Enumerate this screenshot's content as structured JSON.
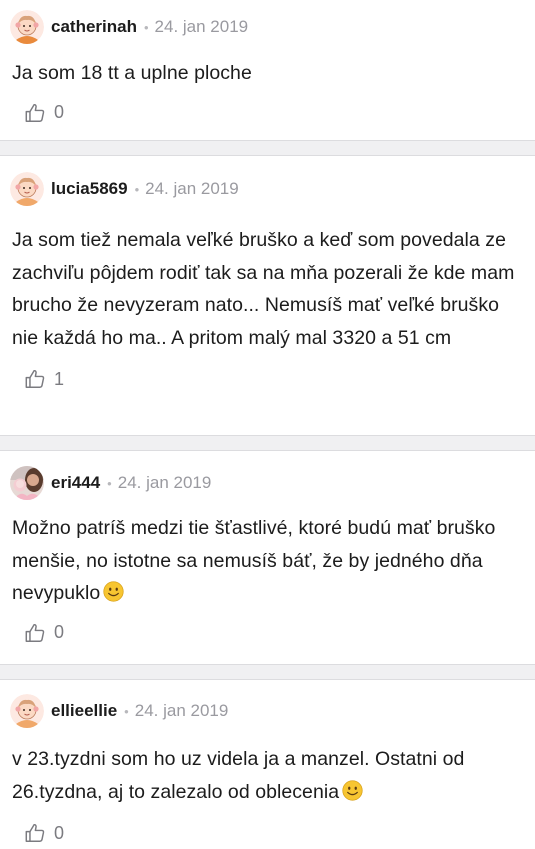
{
  "comments": [
    {
      "user": "catherinah",
      "separator": "•",
      "date": "24. jan 2019",
      "text": "Ja som 18 tt a uplne ploche",
      "likes": "0",
      "avatar_icon": "baby-girl-avatar-icon"
    },
    {
      "user": "lucia5869",
      "separator": "•",
      "date": "24. jan 2019",
      "text": "Ja som tiež nemala veľké bruško a keď som povedala ze zachviľu pôjdem rodiť tak sa na mňa pozerali že kde mam brucho že nevyzeram nato... Nemusíš mať veľké bruško nie každá ho ma.. A pritom malý mal 3320 a 51 cm",
      "likes": "1",
      "avatar_icon": "baby-girl-avatar-icon"
    },
    {
      "user": "eri444",
      "separator": "•",
      "date": "24. jan 2019",
      "text": "Možno patríš medzi tie šťastlivé, ktoré budú mať bruško menšie, no istotne sa nemusíš báť, že by jedného dňa nevypuklo",
      "likes": "0",
      "avatar_icon": "photo-avatar-icon",
      "emoji": "smiley-emoji-icon"
    },
    {
      "user": "ellieellie",
      "separator": "•",
      "date": "24. jan 2019",
      "text": "v 23.tyzdni som ho uz videla ja a manzel. Ostatni od 26.tyzdna, aj to zalezalo od oblecenia",
      "likes": "0",
      "avatar_icon": "baby-girl-avatar-icon",
      "emoji": "smiley-emoji-icon"
    }
  ],
  "colors": {
    "text": "#1c1c1c",
    "muted": "#9a9aa0",
    "separator_bg": "#f0f0f2",
    "like_icon": "#7b7b80",
    "emoji_yellow": "#f7c531"
  }
}
